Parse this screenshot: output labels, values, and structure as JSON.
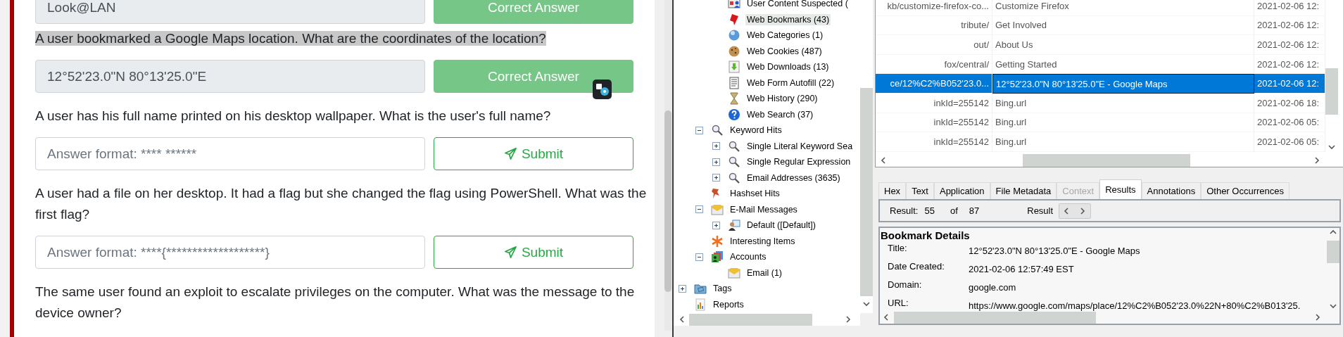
{
  "quiz": {
    "items": [
      {
        "field": {
          "value": "Look@LAN"
        },
        "button": {
          "kind": "correct",
          "label": "Correct Answer"
        }
      },
      {
        "question": "A user bookmarked a Google Maps location. What are the coordinates of the location?",
        "highlighted": true,
        "field": {
          "value": "12°52'23.0\"N 80°13'25.0\"E"
        },
        "button": {
          "kind": "correct",
          "label": "Correct Answer"
        }
      },
      {
        "question": "A user has his full name printed on his desktop wallpaper. What is the user's full name?",
        "highlighted": false,
        "field": {
          "placeholder": "Answer format: **** ******"
        },
        "button": {
          "kind": "submit",
          "label": "Submit"
        }
      },
      {
        "question": "A user had a file on her desktop. It had a flag but she changed the flag using PowerShell. What was the first flag?",
        "highlighted": false,
        "field": {
          "placeholder": "Answer format: ****{*******************}"
        },
        "button": {
          "kind": "submit",
          "label": "Submit"
        }
      },
      {
        "question": "The same user found an exploit to escalate privileges on the computer. What was the message to the device owner?",
        "highlighted": false
      }
    ]
  },
  "tree": {
    "items": [
      {
        "children": [
          {
            "children": [
              {
                "label": "User Content Suspected (",
                "kind": "idcard",
                "selected": false
              },
              {
                "label": "Web Bookmarks (43)",
                "kind": "bookmark",
                "selected": true
              },
              {
                "label": "Web Categories (1)",
                "kind": "globe",
                "selected": false
              },
              {
                "label": "Web Cookies (487)",
                "kind": "cookie",
                "selected": false
              },
              {
                "label": "Web Downloads (13)",
                "kind": "download",
                "selected": false
              },
              {
                "label": "Web Form Autofill (22)",
                "kind": "form",
                "selected": false
              },
              {
                "label": "Web History (290)",
                "kind": "hourglass",
                "selected": false
              },
              {
                "label": "Web Search (37)",
                "kind": "help",
                "selected": false
              }
            ]
          },
          {
            "label": "Keyword Hits",
            "kind": "search",
            "selected": false,
            "expanded": true,
            "children": [
              {
                "label": "Single Literal Keyword Sea",
                "kind": "search",
                "selected": false,
                "expanded": false
              },
              {
                "label": "Single Regular Expression",
                "kind": "search",
                "selected": false,
                "expanded": false
              },
              {
                "label": "Email Addresses (3635)",
                "kind": "search",
                "selected": false,
                "expanded": false
              }
            ]
          },
          {
            "label": "Hashset Hits",
            "kind": "pin",
            "selected": false
          },
          {
            "label": "E-Mail Messages",
            "kind": "envelope",
            "selected": false,
            "expanded": true,
            "children": [
              {
                "label": "Default ([Default])",
                "kind": "contact",
                "selected": false,
                "expanded": false
              }
            ]
          },
          {
            "label": "Interesting Items",
            "kind": "asterisk",
            "selected": false
          },
          {
            "label": "Accounts",
            "kind": "contacts",
            "selected": false,
            "expanded": true,
            "children": [
              {
                "label": "Email (1)",
                "kind": "envelope",
                "selected": false
              }
            ]
          }
        ]
      },
      {
        "label": "Tags",
        "kind": "folder",
        "selected": false,
        "expanded": false
      },
      {
        "label": "Reports",
        "kind": "chart",
        "selected": false
      }
    ]
  },
  "table": {
    "rows": [
      {
        "cells": [
          "kb/customize-firefox-co...",
          "Customize Firefox",
          "2021-02-06 12:"
        ],
        "selected": false
      },
      {
        "cells": [
          "tribute/",
          "Get Involved",
          "2021-02-06 12:"
        ],
        "selected": false
      },
      {
        "cells": [
          "out/",
          "About Us",
          "2021-02-06 12:"
        ],
        "selected": false
      },
      {
        "cells": [
          "fox/central/",
          "Getting Started",
          "2021-02-06 12:"
        ],
        "selected": false
      },
      {
        "cells": [
          "ce/12%C2%B052'23.0...",
          "12°52'23.0\"N 80°13'25.0\"E - Google Maps",
          "2021-02-06 12:"
        ],
        "selected": true
      },
      {
        "cells": [
          "inkId=255142",
          "Bing.url",
          "2021-02-06 18:"
        ],
        "selected": false
      },
      {
        "cells": [
          "inkId=255142",
          "Bing.url",
          "2021-02-06 05:"
        ],
        "selected": false
      },
      {
        "cells": [
          "inkId=255142",
          "Bing.url",
          "2021-02-06 05:"
        ],
        "selected": false
      }
    ]
  },
  "viewer": {
    "tabs": [
      {
        "label": "Hex",
        "selected": false,
        "disabled": false
      },
      {
        "label": "Text",
        "selected": false,
        "disabled": false
      },
      {
        "label": "Application",
        "selected": false,
        "disabled": false
      },
      {
        "label": "File Metadata",
        "selected": false,
        "disabled": false
      },
      {
        "label": "Context",
        "selected": false,
        "disabled": true
      },
      {
        "label": "Results",
        "selected": true,
        "disabled": false
      },
      {
        "label": "Annotations",
        "selected": false,
        "disabled": false
      },
      {
        "label": "Other Occurrences",
        "selected": false,
        "disabled": false
      }
    ],
    "result_bar": {
      "label": "Result:",
      "current": "55",
      "of": "of",
      "total": "87",
      "nav_label": "Result"
    },
    "details": {
      "heading": "Bookmark Details",
      "fields": [
        {
          "label": "Title:",
          "value": "12°52'23.0\"N 80°13'25.0\"E - Google Maps"
        },
        {
          "label": "Date Created:",
          "value": "2021-02-06 12:57:49 EST"
        },
        {
          "label": "Domain:",
          "value": "google.com"
        },
        {
          "label": "URL:",
          "value": "https://www.google.com/maps/place/12%C2%B052'23.0%22N+80%C2%B013'25."
        }
      ]
    }
  }
}
